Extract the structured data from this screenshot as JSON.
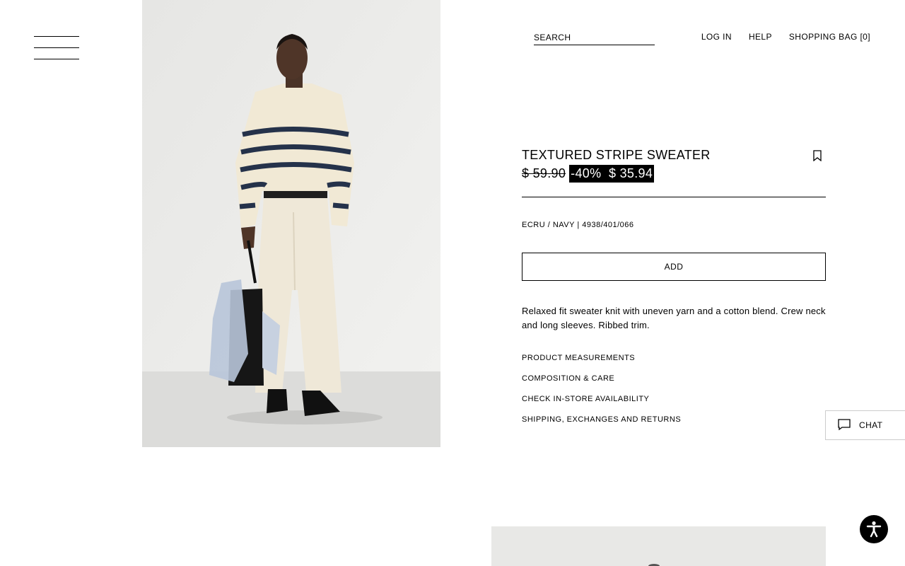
{
  "header": {
    "search_placeholder": "SEARCH",
    "nav": {
      "login": "LOG IN",
      "help": "HELP",
      "bag": "SHOPPING BAG [0]"
    }
  },
  "product": {
    "title": "TEXTURED STRIPE SWEATER",
    "old_price": "$ 59.90",
    "sale_label": "-40%  $ 35.94",
    "color_sku": "ECRU / NAVY | 4938/401/066",
    "add_label": "ADD",
    "description": "Relaxed fit sweater knit with uneven yarn and a cotton blend. Crew neck and long sleeves. Ribbed trim.",
    "links": [
      "PRODUCT MEASUREMENTS",
      "COMPOSITION & CARE",
      "CHECK IN-STORE AVAILABILITY",
      "SHIPPING, EXCHANGES AND RETURNS"
    ]
  },
  "chat": {
    "label": "CHAT"
  },
  "icons": {
    "menu": "hamburger-menu-icon",
    "bookmark": "bookmark-icon",
    "chat": "chat-bubble-icon",
    "accessibility": "accessibility-icon"
  },
  "colors": {
    "text": "#000000",
    "background": "#ffffff",
    "sale_bg": "#000000",
    "sale_text": "#ffffff"
  }
}
